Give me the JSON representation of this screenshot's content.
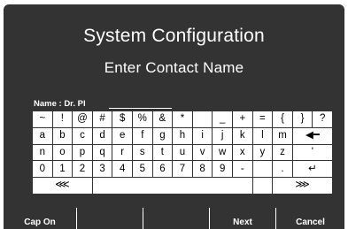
{
  "screen": {
    "title": "System Configuration",
    "subtitle": "Enter Contact Name"
  },
  "entry": {
    "label": "Name : Dr. Pl"
  },
  "keyboard": {
    "rows": [
      [
        "~",
        "!",
        "@",
        "#",
        "$",
        "%",
        "&",
        "*",
        "",
        "+",
        "=",
        "{",
        "}",
        "?"
      ],
      [
        "a",
        "b",
        "c",
        "d",
        "e",
        "f",
        "g",
        "h",
        "i",
        "j",
        "k",
        "l",
        "m",
        "◀━"
      ],
      [
        "n",
        "o",
        "p",
        "q",
        "r",
        "s",
        "t",
        "u",
        "v",
        "w",
        "x",
        "y",
        "z",
        "'"
      ],
      [
        "0",
        "1",
        "2",
        "3",
        "4",
        "5",
        "6",
        "7",
        "8",
        "9",
        "-",
        ".",
        "↵"
      ],
      [
        "⋘",
        "",
        "⋙"
      ]
    ]
  },
  "softkeys": {
    "cap": "Cap On",
    "blank1": "",
    "blank2": "",
    "next": "Next",
    "cancel": "Cancel"
  }
}
